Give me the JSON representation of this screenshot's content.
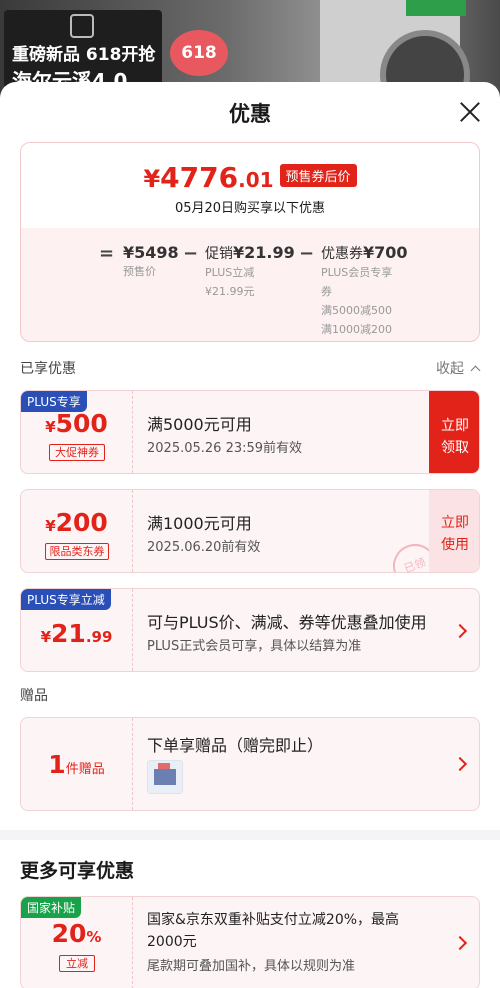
{
  "background": {
    "ad_line1": "重磅新品 618开抢",
    "ad_line2": "海尔云溪4.0",
    "badge_618": "618"
  },
  "sheet": {
    "title": "优惠"
  },
  "summary": {
    "currency": "¥",
    "price_integer": "4776",
    "price_decimal": ".01",
    "price_tag": "预售券后价",
    "date_line": "05月20日购买享以下优惠",
    "equals": "=",
    "presale_price": "¥5498",
    "presale_label": "预售价",
    "minus1": "−",
    "promo_label": "促销",
    "promo_amount": "¥21.99",
    "promo_sub1": "PLUS立减",
    "promo_sub2": "¥21.99元",
    "minus2": "−",
    "coupon_label": "优惠券",
    "coupon_amount": "¥700",
    "coupon_sub1": "PLUS会员专享",
    "coupon_sub2": "券",
    "coupon_sub3": "满5000减500",
    "coupon_sub4": "满1000减200"
  },
  "enjoyed": {
    "label": "已享优惠",
    "collapse": "收起"
  },
  "coupons": [
    {
      "badge": "PLUS专享",
      "currency": "¥",
      "amount": "500",
      "chip": "大促神券",
      "title": "满5000元可用",
      "valid": "2025.05.26 23:59前有效",
      "action_line1": "立即",
      "action_line2": "领取"
    },
    {
      "currency": "¥",
      "amount": "200",
      "chip": "限品类东券",
      "title": "满1000元可用",
      "valid": "2025.06.20前有效",
      "action_line1": "立即",
      "action_line2": "使用",
      "stamp": "已领"
    },
    {
      "badge": "PLUS专享立减",
      "currency": "¥",
      "amount": "21",
      "decimal": ".99",
      "title": "可与PLUS价、满减、券等优惠叠加使用",
      "sub": "PLUS正式会员可享，具体以结算为准"
    }
  ],
  "gifts": {
    "label": "赠品",
    "count": "1",
    "unit": "件赠品",
    "title": "下单享赠品（赠完即止）"
  },
  "more": {
    "title": "更多可享优惠",
    "badge": "国家补贴",
    "amount": "20",
    "percent": "%",
    "chip": "立减",
    "title_line1": "国家&京东双重补贴支付立减20%，最高",
    "title_line2": "2000元",
    "sub": "尾款期可叠加国补，具体以规则为准"
  },
  "colors": {
    "accent_red": "#e2231a",
    "plus_blue": "#2a4fb7",
    "subsidy_green": "#18a34a",
    "card_bg": "#fdf4f5"
  }
}
